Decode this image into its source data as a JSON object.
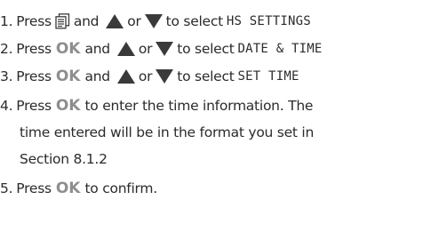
{
  "steps": [
    {
      "number": "1.",
      "press": "Press",
      "and": "and",
      "or": "or",
      "select": "to select",
      "menu": "HS SETTINGS"
    },
    {
      "number": "2.",
      "press": "Press",
      "ok": "OK",
      "and": "and",
      "or": "or",
      "select": "to select",
      "menu": "DATE & TIME"
    },
    {
      "number": "3.",
      "press": "Press",
      "ok": "OK",
      "and": "and",
      "or": "or",
      "select": "to select",
      "menu": "SET TIME"
    },
    {
      "number": "4.",
      "press": "Press",
      "ok": "OK",
      "text_line1": "to enter the time information. The",
      "text_line2": "time entered will be in the format you set in",
      "text_line3": "Section 8.1.2"
    },
    {
      "number": "5.",
      "press": "Press",
      "ok": "OK",
      "text_line1": "to confirm."
    }
  ],
  "icons": {
    "menu": "menu-list-icon",
    "up": "up-arrow-icon",
    "down": "down-arrow-icon"
  },
  "colors": {
    "arrow_fill": "#3a3a3a",
    "ok_text": "#8e8e8e",
    "body_text": "#2b2b2b"
  }
}
